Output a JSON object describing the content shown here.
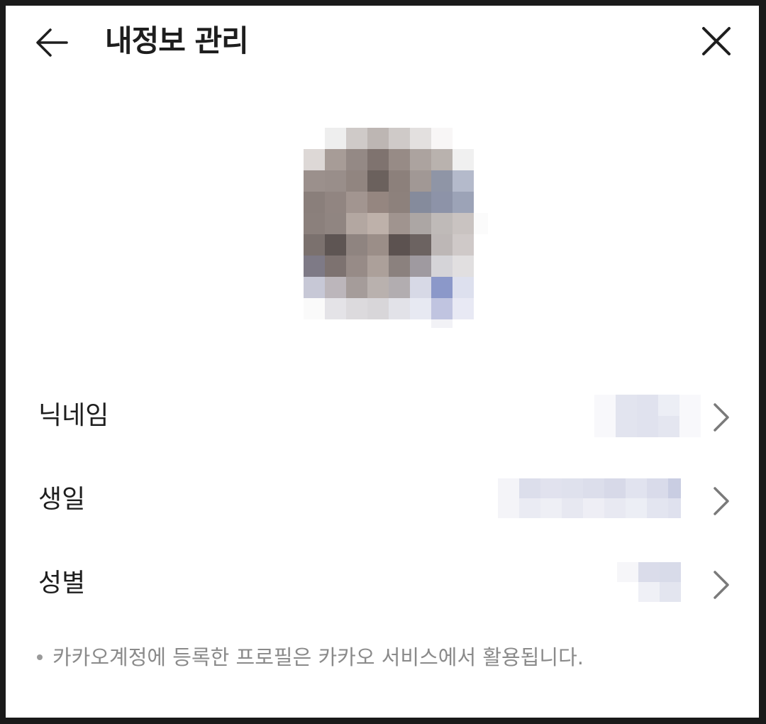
{
  "header": {
    "title": "내정보 관리",
    "back_icon": "arrow-left-icon",
    "close_icon": "close-icon"
  },
  "profile": {
    "avatar_icon": "profile-avatar-image"
  },
  "rows": [
    {
      "label": "닉네임",
      "icon": "chevron-right-icon"
    },
    {
      "label": "생일",
      "icon": "chevron-right-icon"
    },
    {
      "label": "성별",
      "icon": "chevron-right-icon"
    }
  ],
  "notice": {
    "text": "카카오계정에 등록한 프로필은 카카오 서비스에서 활용됩니다."
  },
  "colors": {
    "text_primary": "#1e1e1e",
    "text_secondary": "#8a8a8a",
    "background": "#ffffff"
  }
}
